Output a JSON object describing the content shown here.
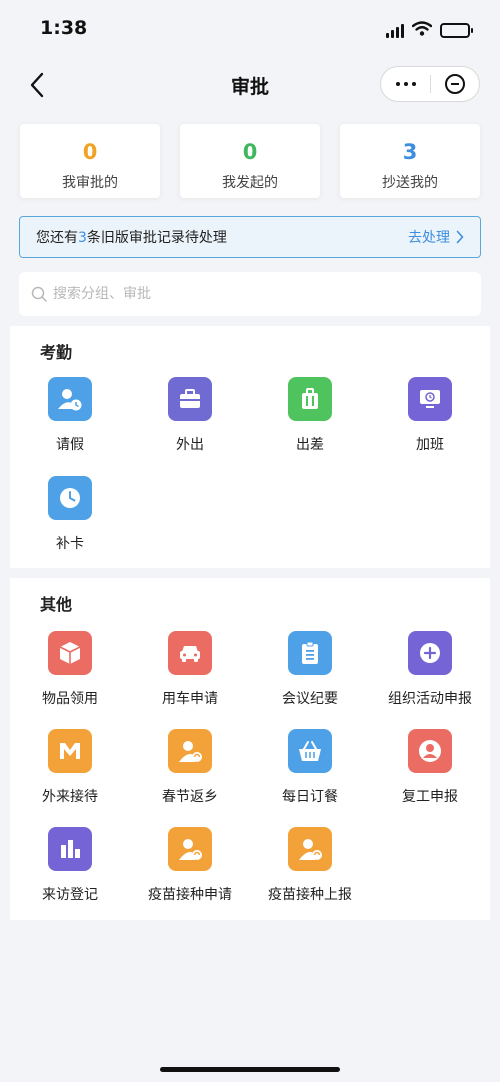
{
  "status_bar": {
    "time": "1:38"
  },
  "nav": {
    "title": "审批"
  },
  "stats": [
    {
      "value": "0",
      "label": "我审批的",
      "color": "#f0a427"
    },
    {
      "value": "0",
      "label": "我发起的",
      "color": "#3fb75f"
    },
    {
      "value": "3",
      "label": "抄送我的",
      "color": "#3d8ee0"
    }
  ],
  "notice": {
    "prefix": "您还有",
    "count": "3",
    "suffix": "条旧版审批记录待处理",
    "action": "去处理"
  },
  "search": {
    "placeholder": "搜索分组、审批"
  },
  "sections": [
    {
      "title": "考勤",
      "items": [
        {
          "label": "请假",
          "color": "#4ea1e6",
          "icon": "person-clock-icon"
        },
        {
          "label": "外出",
          "color": "#6f6bd3",
          "icon": "briefcase-icon"
        },
        {
          "label": "出差",
          "color": "#4fc35d",
          "icon": "luggage-icon"
        },
        {
          "label": "加班",
          "color": "#7464d6",
          "icon": "monitor-clock-icon"
        },
        {
          "label": "补卡",
          "color": "#4ea1e6",
          "icon": "clock-icon"
        }
      ]
    },
    {
      "title": "其他",
      "items": [
        {
          "label": "物品领用",
          "color": "#ea6c62",
          "icon": "box-icon"
        },
        {
          "label": "用车申请",
          "color": "#ea6c62",
          "icon": "car-icon"
        },
        {
          "label": "会议纪要",
          "color": "#4ea1e6",
          "icon": "clipboard-icon"
        },
        {
          "label": "组织活动申报",
          "color": "#7464d6",
          "icon": "plus-circle-icon"
        },
        {
          "label": "外来接待",
          "color": "#f3a23a",
          "icon": "people-icon"
        },
        {
          "label": "春节返乡",
          "color": "#f3a23a",
          "icon": "person-refresh-icon"
        },
        {
          "label": "每日订餐",
          "color": "#4ea1e6",
          "icon": "basket-icon"
        },
        {
          "label": "复工申报",
          "color": "#ea6c62",
          "icon": "person-circle-icon"
        },
        {
          "label": "来访登记",
          "color": "#7464d6",
          "icon": "bar-chart-icon"
        },
        {
          "label": "疫苗接种申请",
          "color": "#f3a23a",
          "icon": "person-refresh-icon"
        },
        {
          "label": "疫苗接种上报",
          "color": "#f3a23a",
          "icon": "person-refresh-icon"
        }
      ]
    }
  ]
}
